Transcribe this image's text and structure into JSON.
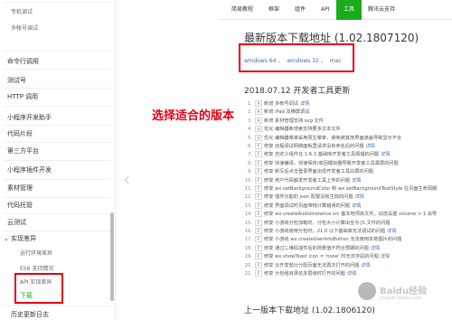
{
  "sidebar": {
    "items": [
      {
        "label": "专机调试",
        "type": "sub"
      },
      {
        "label": "多帐号调试",
        "type": "sub"
      },
      {
        "label": "命令行调用",
        "type": "main"
      },
      {
        "label": "测试号",
        "type": "main"
      },
      {
        "label": "HTTP 调用",
        "type": "main"
      },
      {
        "label": "小程序开发助手",
        "type": "main"
      },
      {
        "label": "代码片段",
        "type": "main"
      },
      {
        "label": "第三方平台",
        "type": "main"
      },
      {
        "label": "小程序插件开发",
        "type": "main"
      },
      {
        "label": "素材管理",
        "type": "main"
      },
      {
        "label": "代码托管",
        "type": "main"
      },
      {
        "label": "云测试",
        "type": "main"
      },
      {
        "label": "实现差异",
        "type": "main"
      },
      {
        "label": "运行环境差异",
        "type": "sub"
      },
      {
        "label": "ES6 支持情况",
        "type": "sub"
      },
      {
        "label": "API 实现差异",
        "type": "sub"
      },
      {
        "label": "下载",
        "type": "main"
      },
      {
        "label": "历史更新日志",
        "type": "main"
      }
    ]
  },
  "nav": {
    "items": [
      "简易教程",
      "框架",
      "组件",
      "API",
      "工具",
      "腾讯云支持"
    ],
    "active": "工具"
  },
  "main": {
    "title": "最新版本下载地址 (1.02.1807120)",
    "links": [
      "windows 64",
      "windows 32",
      "mac"
    ],
    "separator": "、",
    "update_title": "2018.07.12 开发者工具更新",
    "changes": [
      {
        "num": "1.",
        "tag": "A",
        "text": "新增 多帐号调试",
        "detail": "详情"
      },
      {
        "num": "2.",
        "tag": "A",
        "text": "新增 iPad 及横屏调试",
        "detail": ""
      },
      {
        "num": "3.",
        "tag": "A",
        "text": "新增 素材管理支持 svg 文件",
        "detail": ""
      },
      {
        "num": "4.",
        "tag": "U",
        "text": "优化 编辑器新增索支持要多文本文件",
        "detail": ""
      },
      {
        "num": "5.",
        "tag": "U",
        "text": "优化 编辑器菜单采用原生菜单，避免被其他界面遮盖导致显示不全",
        "detail": ""
      },
      {
        "num": "6.",
        "tag": "F",
        "text": "修复 远程调试网络面板里请求没有命名后的问题",
        "detail": "详情"
      },
      {
        "num": "7.",
        "tag": "F",
        "text": "修复 自定义组件在 1.6.3 基础库开发者工具报错的问题",
        "detail": "详情"
      },
      {
        "num": "8.",
        "tag": "F",
        "text": "修复 快速编译，快速保存/收回模拟器导致开发者工具黑屏的问题",
        "detail": ""
      },
      {
        "num": "9.",
        "tag": "F",
        "text": "修复 新写后点击登录界面出现开发者工具白屏的问题",
        "detail": ""
      },
      {
        "num": "10.",
        "tag": "F",
        "text": "修复 用户代码触发开发者工具上传的问题",
        "detail": "详情"
      },
      {
        "num": "11.",
        "tag": "F",
        "text": "修复 wx.setBackgroundColor 和 wx.setBackgroundTextStyle 在页面生命周期",
        "detail": ""
      },
      {
        "num": "12.",
        "tag": "F",
        "text": "修复 插件功能的 json 配置没有生效的问题",
        "detail": "详情"
      },
      {
        "num": "13.",
        "tag": "F",
        "text": "修复 界面调试时页面堆栈计算错误的问题",
        "detail": "详情"
      },
      {
        "num": "14.",
        "tag": "F",
        "text": "修复 wx.createAudioInstance src 基本地项目文件，动态设置 volume > 1 会导",
        "detail": ""
      },
      {
        "num": "15.",
        "tag": "F",
        "text": "修复 小游戏分包加载时，分包大小计算出全为 JS 文件的问题",
        "detail": ""
      },
      {
        "num": "16.",
        "tag": "F",
        "text": "修复 小游戏使用分包时，21.0 以下基础库无法调试的问题",
        "detail": "详情"
      },
      {
        "num": "17.",
        "tag": "F",
        "text": "修复 小游戏 wx.createUserInfoButton 无法使用本地图片的问题",
        "detail": ""
      },
      {
        "num": "18.",
        "tag": "F",
        "text": "修复 通过二维码插件后的场景值不符合预期的问题",
        "detail": "详情"
      },
      {
        "num": "19.",
        "tag": "F",
        "text": "修复 wx.showToast icon = 'none' 时无法字段的问题",
        "detail": "详情"
      },
      {
        "num": "20.",
        "tag": "F",
        "text": "修复 云开发部分分配页面无法再次打开的问题",
        "detail": "详情"
      },
      {
        "num": "21.",
        "tag": "F",
        "text": "修复 分包组目录名多层级时打开的问题",
        "detail": "详情"
      }
    ],
    "prev_title": "上一版本下载地址 (1.02.1806120)"
  },
  "annotation": {
    "text": "选择适合的版本",
    "color": "#e60012"
  },
  "watermark": {
    "text": "Baidu经验",
    "url": "jingyan.baidu.com"
  },
  "colors": {
    "accent": "#1aad19",
    "link": "#3d69a6",
    "highlight": "#e60012"
  }
}
